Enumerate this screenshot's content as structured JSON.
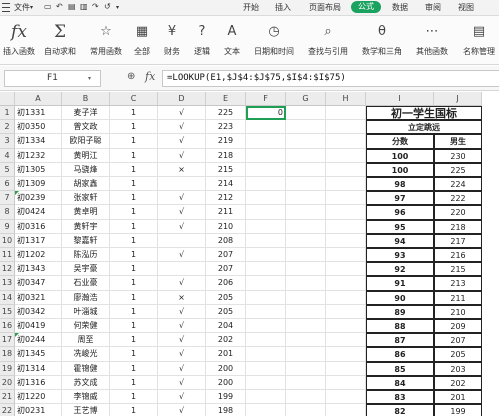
{
  "menu": {
    "file": "文件",
    "tabs": [
      "开始",
      "插入",
      "页面布局",
      "公式",
      "数据",
      "审阅",
      "视图"
    ],
    "active_tab": "公式"
  },
  "ribbon": {
    "buttons": [
      {
        "label": "插入函数",
        "icon": "fx"
      },
      {
        "label": "自动求和",
        "icon": "Σ"
      },
      {
        "label": "常用函数",
        "icon": "☆"
      },
      {
        "label": "全部",
        "icon": "▦"
      },
      {
        "label": "财务",
        "icon": "¥"
      },
      {
        "label": "逻辑",
        "icon": "?"
      },
      {
        "label": "文本",
        "icon": "A"
      },
      {
        "label": "日期和时间",
        "icon": "◷"
      },
      {
        "label": "查找与引用",
        "icon": "⌕"
      },
      {
        "label": "数学和三角",
        "icon": "θ"
      },
      {
        "label": "其他函数",
        "icon": "⋯"
      },
      {
        "label": "名称管理",
        "icon": "▤"
      }
    ]
  },
  "formula_bar": {
    "name_box": "F1",
    "fx": "fx",
    "formula": "=LOOKUP(E1,$J$4:$J$75,$I$4:$I$75)"
  },
  "columns": [
    "A",
    "B",
    "C",
    "D",
    "E",
    "F",
    "G",
    "H",
    "I",
    "J"
  ],
  "rows": [
    {
      "n": "1",
      "a": "初1331",
      "b": "麦子洋",
      "c": "1",
      "d": "√",
      "e": "225",
      "f": "0"
    },
    {
      "n": "2",
      "a": "初0350",
      "b": "曾文政",
      "c": "1",
      "d": "√",
      "e": "223",
      "f": ""
    },
    {
      "n": "3",
      "a": "初1334",
      "b": "欧阳子聪",
      "c": "1",
      "d": "√",
      "e": "219",
      "f": ""
    },
    {
      "n": "4",
      "a": "初1232",
      "b": "黄明江",
      "c": "1",
      "d": "√",
      "e": "218",
      "f": ""
    },
    {
      "n": "5",
      "a": "初1305",
      "b": "马骁烽",
      "c": "1",
      "d": "×",
      "e": "215",
      "f": ""
    },
    {
      "n": "6",
      "a": "初1309",
      "b": "胡家鑫",
      "c": "1",
      "d": "",
      "e": "214",
      "f": ""
    },
    {
      "n": "7",
      "a": "初0239",
      "b": "张家轩",
      "c": "1",
      "d": "√",
      "e": "212",
      "f": ""
    },
    {
      "n": "8",
      "a": "初0424",
      "b": "黄卓明",
      "c": "1",
      "d": "√",
      "e": "211",
      "f": ""
    },
    {
      "n": "9",
      "a": "初0316",
      "b": "黄轩宇",
      "c": "1",
      "d": "√",
      "e": "210",
      "f": ""
    },
    {
      "n": "10",
      "a": "初1317",
      "b": "黎嘉轩",
      "c": "1",
      "d": "",
      "e": "208",
      "f": ""
    },
    {
      "n": "11",
      "a": "初1202",
      "b": "陈泓历",
      "c": "1",
      "d": "√",
      "e": "207",
      "f": ""
    },
    {
      "n": "12",
      "a": "初1343",
      "b": "吴宇豪",
      "c": "1",
      "d": "",
      "e": "207",
      "f": ""
    },
    {
      "n": "13",
      "a": "初0347",
      "b": "石业豪",
      "c": "1",
      "d": "√",
      "e": "206",
      "f": ""
    },
    {
      "n": "14",
      "a": "初0321",
      "b": "廖瀚浩",
      "c": "1",
      "d": "×",
      "e": "205",
      "f": ""
    },
    {
      "n": "15",
      "a": "初0342",
      "b": "叶淄城",
      "c": "1",
      "d": "√",
      "e": "205",
      "f": ""
    },
    {
      "n": "16",
      "a": "初0419",
      "b": "何荣健",
      "c": "1",
      "d": "√",
      "e": "204",
      "f": ""
    },
    {
      "n": "17",
      "a": "初0244",
      "b": "周至",
      "c": "1",
      "d": "√",
      "e": "202",
      "f": ""
    },
    {
      "n": "18",
      "a": "初1345",
      "b": "冼峻光",
      "c": "1",
      "d": "√",
      "e": "201",
      "f": ""
    },
    {
      "n": "19",
      "a": "初1314",
      "b": "霍锦健",
      "c": "1",
      "d": "√",
      "e": "200",
      "f": ""
    },
    {
      "n": "20",
      "a": "初1316",
      "b": "苏文成",
      "c": "1",
      "d": "√",
      "e": "200",
      "f": ""
    },
    {
      "n": "21",
      "a": "初1220",
      "b": "李锦威",
      "c": "1",
      "d": "√",
      "e": "199",
      "f": ""
    },
    {
      "n": "22",
      "a": "初0231",
      "b": "王艺博",
      "c": "1",
      "d": "√",
      "e": "198",
      "f": ""
    }
  ],
  "table": {
    "title": "初一学生国标",
    "subtitle": "立定跳远",
    "headers": [
      "分数",
      "男生"
    ],
    "rows": [
      [
        "100",
        "230"
      ],
      [
        "100",
        "225"
      ],
      [
        "98",
        "224"
      ],
      [
        "97",
        "222"
      ],
      [
        "96",
        "220"
      ],
      [
        "95",
        "218"
      ],
      [
        "94",
        "217"
      ],
      [
        "93",
        "216"
      ],
      [
        "92",
        "215"
      ],
      [
        "91",
        "213"
      ],
      [
        "90",
        "211"
      ],
      [
        "89",
        "210"
      ],
      [
        "88",
        "209"
      ],
      [
        "87",
        "207"
      ],
      [
        "86",
        "205"
      ],
      [
        "85",
        "203"
      ],
      [
        "84",
        "202"
      ],
      [
        "83",
        "201"
      ],
      [
        "82",
        "199"
      ]
    ]
  },
  "colors": {
    "accent": "#1aa260",
    "selection": "#1e9f53"
  }
}
